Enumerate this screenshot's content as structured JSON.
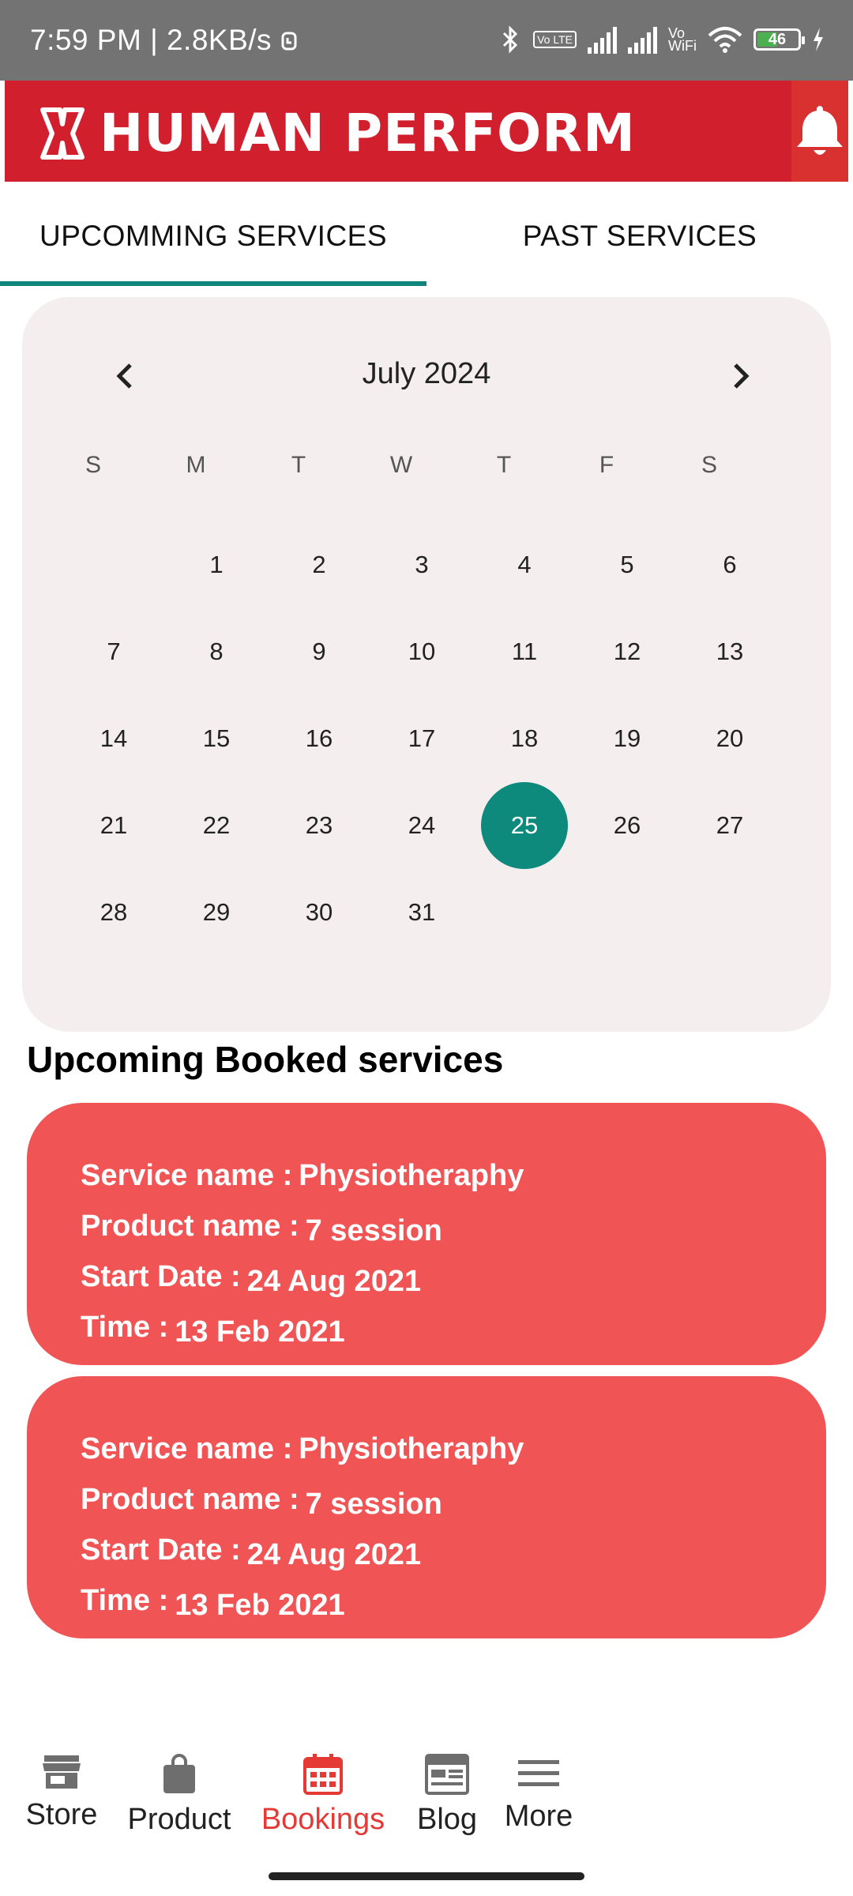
{
  "status_bar": {
    "time_speed": "7:59 PM | 2.8KB/s",
    "volte_label": "Vo LTE",
    "vowifi_label": "Vo WiFi",
    "battery": "46"
  },
  "header": {
    "brand": "HUMAN PERFORM",
    "brand_color": "#d21f2e"
  },
  "tabs": [
    {
      "label": "UPCOMMING SERVICES",
      "active": true
    },
    {
      "label": "PAST SERVICES",
      "active": false
    }
  ],
  "calendar": {
    "month_title": "July 2024",
    "weekdays": [
      "S",
      "M",
      "T",
      "W",
      "T",
      "F",
      "S"
    ],
    "first_weekday_offset": 1,
    "days": [
      "1",
      "2",
      "3",
      "4",
      "5",
      "6",
      "7",
      "8",
      "9",
      "10",
      "11",
      "12",
      "13",
      "14",
      "15",
      "16",
      "17",
      "18",
      "19",
      "20",
      "21",
      "22",
      "23",
      "24",
      "25",
      "26",
      "27",
      "28",
      "29",
      "30",
      "31"
    ],
    "selected": "25",
    "accent_color": "#0e8a7d"
  },
  "section_title": "Upcoming Booked services",
  "bookings": [
    {
      "service_label": "Service name :",
      "service_value": "Physiotheraphy",
      "product_label": "Product name :",
      "product_value": "7 session",
      "start_label": "Start Date :",
      "start_value": "24 Aug 2021",
      "time_label": "Time :",
      "time_value": "13 Feb 2021"
    },
    {
      "service_label": "Service name :",
      "service_value": "Physiotheraphy",
      "product_label": "Product name :",
      "product_value": "7 session",
      "start_label": "Start Date :",
      "start_value": "24 Aug 2021",
      "time_label": "Time :",
      "time_value": "13 Feb 2021"
    }
  ],
  "bottom_nav": [
    {
      "label": "Store",
      "icon": "store-icon"
    },
    {
      "label": "Product",
      "icon": "shopping-bag-icon"
    },
    {
      "label": "Bookings",
      "icon": "calendar-icon",
      "active": true
    },
    {
      "label": "Blog",
      "icon": "newspaper-icon"
    },
    {
      "label": "More",
      "icon": "menu-icon"
    }
  ]
}
